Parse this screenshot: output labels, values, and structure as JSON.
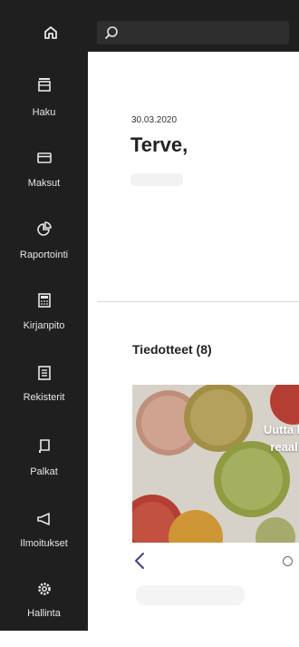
{
  "sidebar": {
    "items": [
      {
        "label": "Haku",
        "icon": "archive-icon"
      },
      {
        "label": "Maksut",
        "icon": "card-icon"
      },
      {
        "label": "Raportointi",
        "icon": "pie-chart-icon"
      },
      {
        "label": "Kirjanpito",
        "icon": "calculator-icon"
      },
      {
        "label": "Rekisterit",
        "icon": "list-box-icon"
      },
      {
        "label": "Palkat",
        "icon": "receipt-icon"
      },
      {
        "label": "Ilmoitukset",
        "icon": "megaphone-icon"
      },
      {
        "label": "Hallinta",
        "icon": "gear-icon"
      }
    ]
  },
  "main": {
    "date": "30.03.2020",
    "greeting": "Terve,",
    "news": {
      "heading": "Tiedotteet (8)",
      "slide_title": "Uutta blo\nreaalia"
    }
  },
  "colors": {
    "sidebar_bg": "#1f1f1f",
    "accent": "#4b3b8f"
  }
}
